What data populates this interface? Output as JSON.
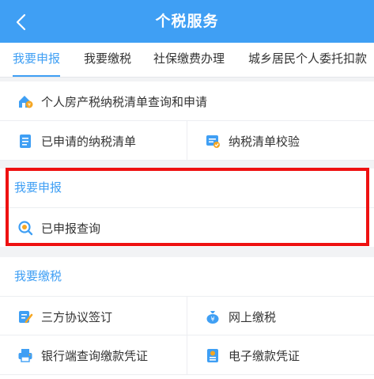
{
  "header": {
    "title": "个税服务",
    "back_icon": "chevron-left-icon"
  },
  "tabs": [
    {
      "label": "我要申报",
      "active": true
    },
    {
      "label": "我要缴税",
      "active": false
    },
    {
      "label": "社保缴费办理",
      "active": false
    },
    {
      "label": "城乡居民个人委托扣款",
      "active": false
    }
  ],
  "top_card": {
    "item_property": {
      "label": "个人房产税纳税清单查询和申请",
      "icon": "house-coin-icon"
    },
    "item_applied": {
      "label": "已申请的纳税清单",
      "icon": "document-list-icon"
    },
    "item_verify": {
      "label": "纳税清单校验",
      "icon": "check-document-icon"
    }
  },
  "declare_section": {
    "title": "我要申报",
    "item_query": {
      "label": "已申报查询",
      "icon": "search-icon"
    }
  },
  "pay_section": {
    "title": "我要缴税",
    "item_agreement": {
      "label": "三方协议签订",
      "icon": "sign-document-icon"
    },
    "item_online_pay": {
      "label": "网上缴税",
      "icon": "money-bag-icon"
    },
    "item_bank_voucher": {
      "label": "银行端查询缴款凭证",
      "icon": "printer-icon"
    },
    "item_e_voucher": {
      "label": "电子缴款凭证",
      "icon": "receipt-icon"
    }
  },
  "colors": {
    "accent": "#3f9ff4",
    "highlight": "#ee1111"
  }
}
